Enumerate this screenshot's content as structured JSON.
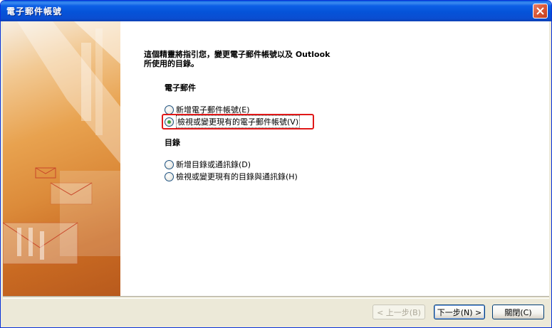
{
  "window": {
    "title": "電子郵件帳號"
  },
  "intro": {
    "line1": "這個精靈將指引您，變更電子郵件帳號以及 Outlook",
    "line2": "所使用的目錄。"
  },
  "email_section": {
    "heading": "電子郵件",
    "options": [
      {
        "label": "新增電子郵件帳號(E)",
        "checked": false
      },
      {
        "label": "檢視或變更現有的電子郵件帳號(V)",
        "checked": true
      }
    ]
  },
  "directory_section": {
    "heading": "目錄",
    "options": [
      {
        "label": "新增目錄或通訊錄(D)",
        "checked": false
      },
      {
        "label": "檢視或變更現有的目錄與通訊錄(H)",
        "checked": false
      }
    ]
  },
  "buttons": {
    "back": "< 上一步(B)",
    "next": "下一步(N) >",
    "close": "關閉(C)"
  },
  "colors": {
    "titlebar": "#0553d8",
    "highlight_border": "#e01818",
    "art_orange": "#dc8b3a"
  }
}
